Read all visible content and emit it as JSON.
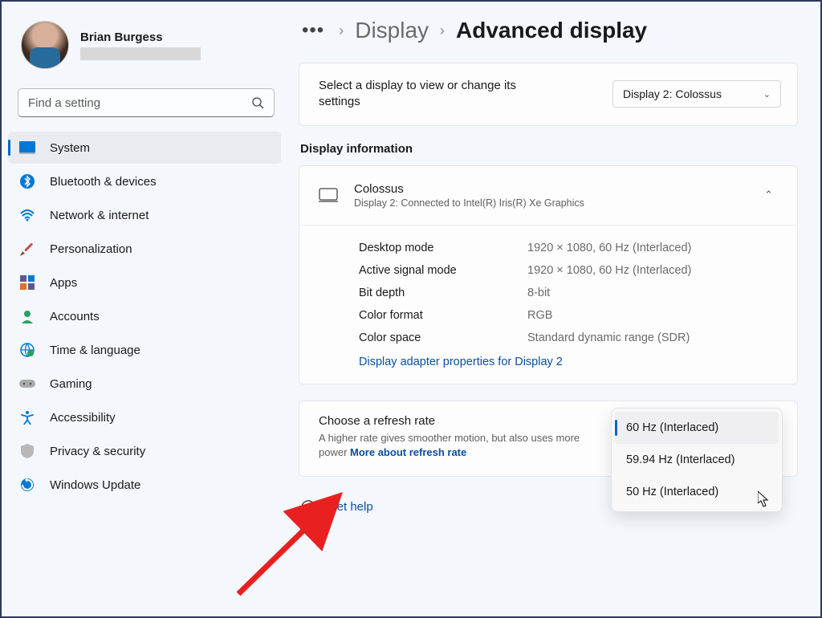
{
  "user": {
    "name": "Brian Burgess"
  },
  "search": {
    "placeholder": "Find a setting"
  },
  "nav": {
    "items": [
      {
        "label": "System",
        "selected": true
      },
      {
        "label": "Bluetooth & devices"
      },
      {
        "label": "Network & internet"
      },
      {
        "label": "Personalization"
      },
      {
        "label": "Apps"
      },
      {
        "label": "Accounts"
      },
      {
        "label": "Time & language"
      },
      {
        "label": "Gaming"
      },
      {
        "label": "Accessibility"
      },
      {
        "label": "Privacy & security"
      },
      {
        "label": "Windows Update"
      }
    ]
  },
  "breadcrumb": {
    "parent": "Display",
    "current": "Advanced display"
  },
  "select_display": {
    "label": "Select a display to view or change its settings",
    "selected": "Display 2: Colossus"
  },
  "section_header": "Display information",
  "info": {
    "title": "Colossus",
    "subtitle": "Display 2: Connected to Intel(R) Iris(R) Xe Graphics",
    "rows": [
      {
        "label": "Desktop mode",
        "value": "1920 × 1080, 60 Hz (Interlaced)"
      },
      {
        "label": "Active signal mode",
        "value": "1920 × 1080, 60 Hz (Interlaced)"
      },
      {
        "label": "Bit depth",
        "value": "8-bit"
      },
      {
        "label": "Color format",
        "value": "RGB"
      },
      {
        "label": "Color space",
        "value": "Standard dynamic range (SDR)"
      }
    ],
    "adapter_link": "Display adapter properties for Display 2"
  },
  "refresh": {
    "title": "Choose a refresh rate",
    "description": "A higher rate gives smoother motion, but also uses more power  ",
    "more_link": "More about refresh rate",
    "options": [
      {
        "label": "60 Hz (Interlaced)",
        "selected": true
      },
      {
        "label": "59.94 Hz (Interlaced)"
      },
      {
        "label": "50 Hz (Interlaced)"
      }
    ]
  },
  "help": {
    "link": "Get help"
  }
}
